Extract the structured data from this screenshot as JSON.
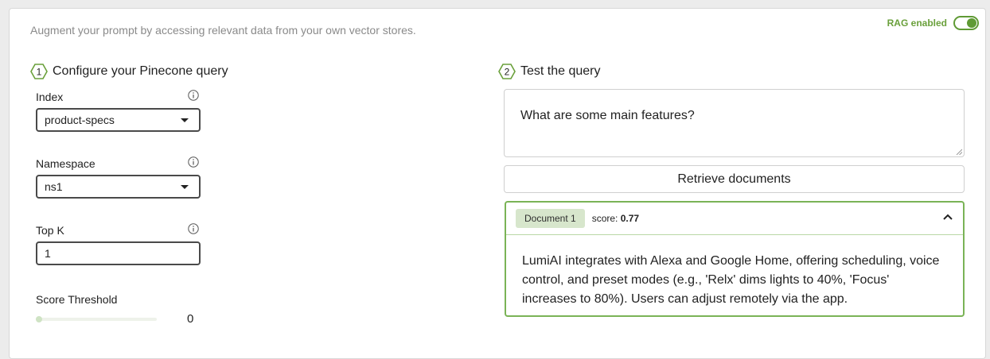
{
  "header": {
    "description": "Augment your prompt by accessing relevant data from your own vector stores.",
    "rag_label": "RAG enabled",
    "rag_enabled": true,
    "accent_color": "#5f9a34"
  },
  "config": {
    "step_number": "1",
    "title": "Configure your Pinecone query",
    "index_label": "Index",
    "index_value": "product-specs",
    "namespace_label": "Namespace",
    "namespace_value": "ns1",
    "topk_label": "Top K",
    "topk_value": "1",
    "threshold_label": "Score Threshold",
    "threshold_value": "0"
  },
  "test": {
    "step_number": "2",
    "title": "Test the query",
    "query_text": "What are some main features?",
    "retrieve_label": "Retrieve documents",
    "result": {
      "badge": "Document 1",
      "score_label": "score:",
      "score_value": "0.77",
      "content": "LumiAI integrates with Alexa and Google Home, offering scheduling, voice control, and preset modes (e.g., 'Relx' dims lights to 40%, 'Focus' increases to 80%). Users can adjust remotely via the app."
    }
  }
}
